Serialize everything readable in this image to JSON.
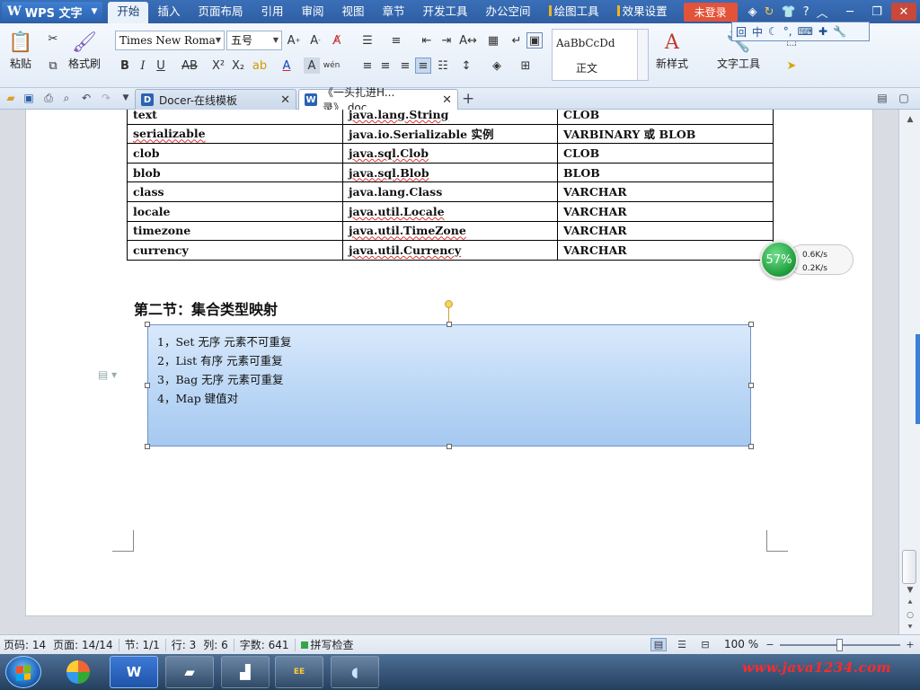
{
  "app": {
    "name": "WPS 文字"
  },
  "menubar": {
    "tabs": [
      {
        "label": "开始"
      },
      {
        "label": "插入"
      },
      {
        "label": "页面布局"
      },
      {
        "label": "引用"
      },
      {
        "label": "审阅"
      },
      {
        "label": "视图"
      },
      {
        "label": "章节"
      },
      {
        "label": "开发工具"
      },
      {
        "label": "办公空间"
      },
      {
        "label": "绘图工具"
      },
      {
        "label": "效果设置"
      }
    ],
    "login_label": "未登录"
  },
  "ribbon": {
    "paste_label": "粘贴",
    "format_painter_label": "格式刷",
    "font_name": "Times New Roma",
    "font_size": "五号",
    "style_sample": "AaBbCcDd",
    "style_name": "正文",
    "new_style_label": "新样式",
    "text_tools_label": "文字工具"
  },
  "tabs": {
    "items": [
      {
        "label": "Docer-在线模板"
      },
      {
        "label": "《一头扎进H...录》.doc"
      }
    ]
  },
  "document": {
    "table_rows": [
      [
        "text",
        "java.lang.String",
        "CLOB"
      ],
      [
        "serializable",
        "java.io.Serializable 实例",
        "VARBINARY 或 BLOB"
      ],
      [
        "clob",
        "java.sql.Clob",
        "CLOB"
      ],
      [
        "blob",
        "java.sql.Blob",
        "BLOB"
      ],
      [
        "class",
        "java.lang.Class",
        "VARCHAR"
      ],
      [
        "locale",
        "java.util.Locale",
        "VARCHAR"
      ],
      [
        "timezone",
        "java.util.TimeZone",
        "VARCHAR"
      ],
      [
        "currency",
        "java.util.Currency",
        "VARCHAR"
      ]
    ],
    "section_heading": "第二节：集合类型映射",
    "textbox_lines": [
      "1，Set 无序   元素不可重复",
      "2，List 有序  元素可重复",
      "3，Bag 无序  元素可重复",
      "4，Map  键值对"
    ]
  },
  "speed_widget": {
    "percent": "57%",
    "upload": "0.6K/s",
    "download": "0.2K/s"
  },
  "statusbar": {
    "page_no": "页码: 14",
    "page_count": "页面: 14/14",
    "section": "节: 1/1",
    "row": "行: 3",
    "column": "列: 6",
    "word_count": "字数: 641",
    "spell_check": "拼写检查",
    "zoom": "100 %"
  },
  "taskbar": {
    "watermark": "www.java1234.com"
  },
  "colors": {
    "menubar": "#3a6fb7",
    "login": "#e3533a",
    "textbox_fill": "#b8d5f5",
    "accent": "#3a80d8"
  }
}
